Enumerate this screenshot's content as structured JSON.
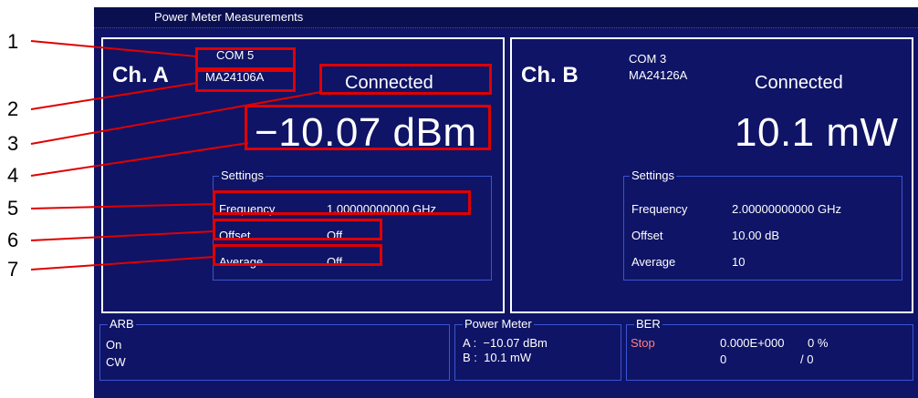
{
  "window": {
    "title": "Power Meter Measurements"
  },
  "channel_a": {
    "label": "Ch. A",
    "port": "COM 5",
    "model": "MA24106A",
    "status": "Connected",
    "reading": "−10.07 dBm",
    "settings": {
      "legend": "Settings",
      "frequency_label": "Frequency",
      "frequency_value": "1.00000000000 GHz",
      "offset_label": "Offset",
      "offset_value": "Off",
      "average_label": "Average",
      "average_value": "Off"
    }
  },
  "channel_b": {
    "label": "Ch. B",
    "port": "COM 3",
    "model": "MA24126A",
    "status": "Connected",
    "reading": "10.1 mW",
    "settings": {
      "legend": "Settings",
      "frequency_label": "Frequency",
      "frequency_value": "2.00000000000 GHz",
      "offset_label": "Offset",
      "offset_value": "10.00 dB",
      "average_label": "Average",
      "average_value": "10"
    }
  },
  "arb": {
    "legend": "ARB",
    "state": "On",
    "mode": "CW"
  },
  "power_meter": {
    "legend": "Power Meter",
    "line_a": "A :  −10.07 dBm",
    "line_b": "B :  10.1 mW"
  },
  "ber": {
    "legend": "BER",
    "state": "Stop",
    "rate": "0.000E+000",
    "percent": "0 %",
    "count": "0",
    "total": "/ 0",
    "state_color": "#ff8080"
  },
  "callouts": [
    "1",
    "2",
    "3",
    "4",
    "5",
    "6",
    "7"
  ],
  "colors": {
    "screen_bg": "#0f1466",
    "highlight": "#e00000",
    "group_border": "#3a55d0"
  }
}
